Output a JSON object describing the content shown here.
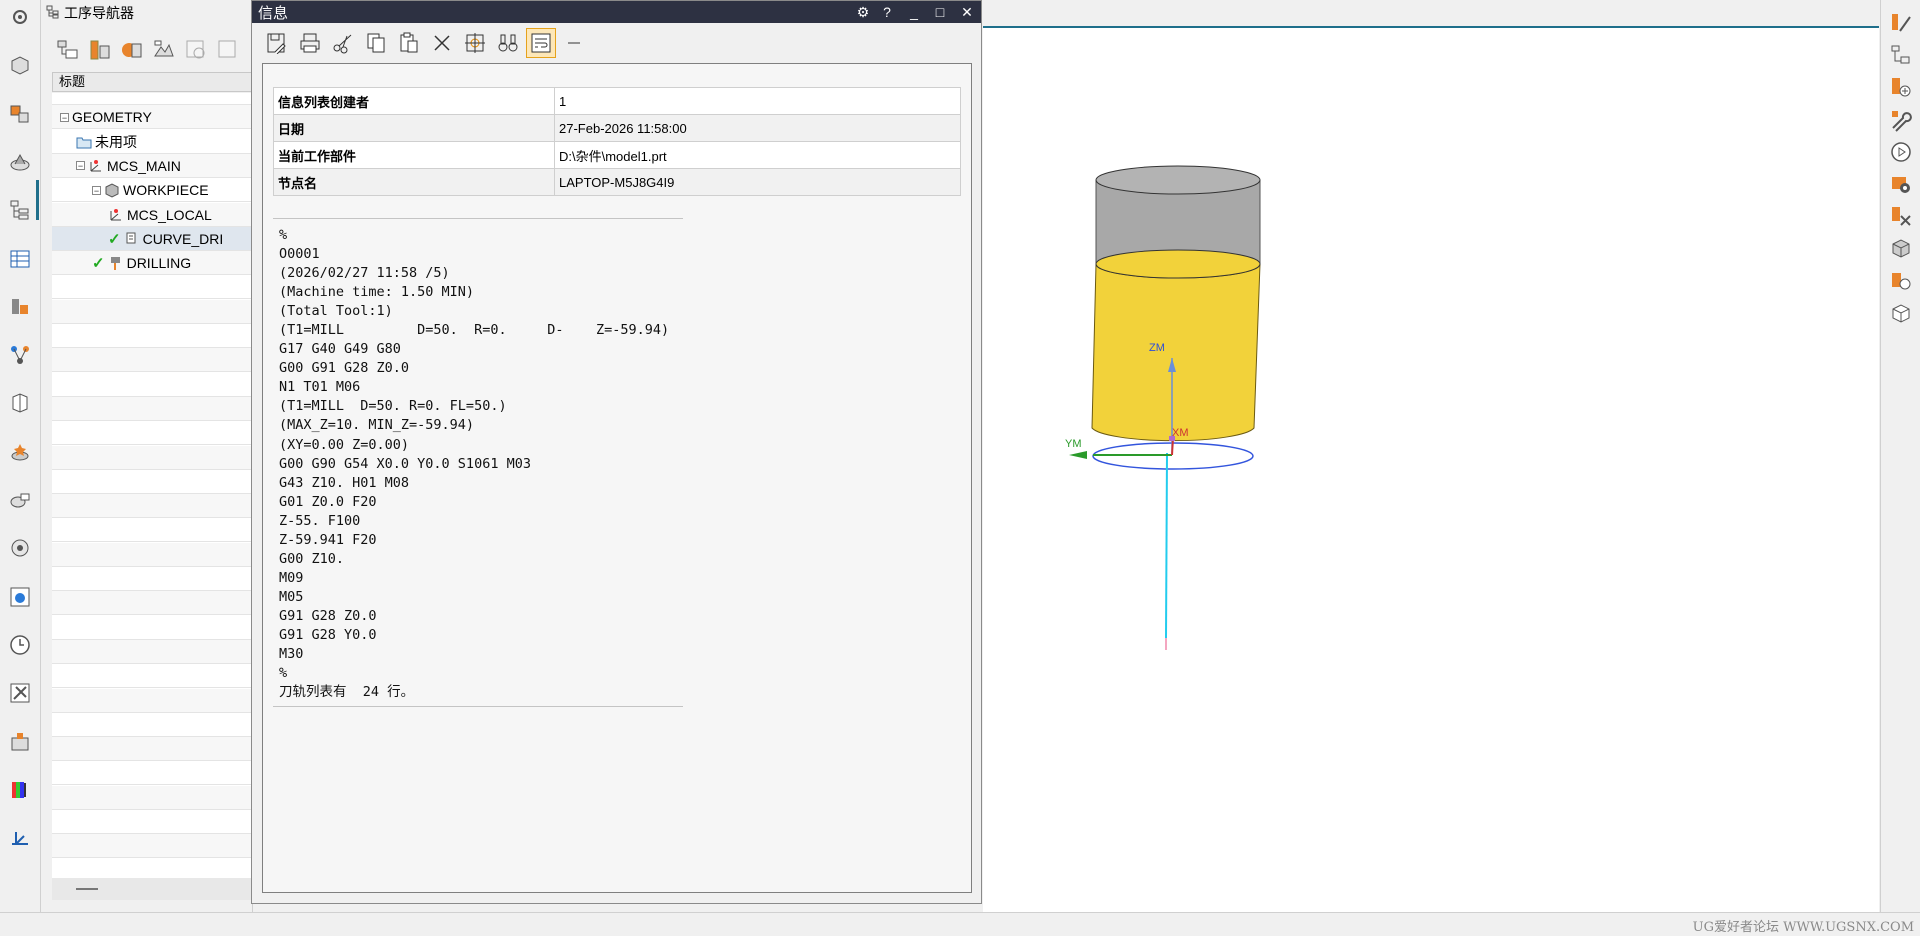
{
  "left_toolbar": {
    "icons": [
      "settings-gear-icon",
      "part-icon",
      "assembly-navigator-icon",
      "constraint-icon",
      "operation-navigator-icon",
      "table-icon",
      "machine-tool-icon",
      "feature-icon",
      "part-family-icon",
      "reuse-icon",
      "process-icon",
      "roles-icon",
      "web-browser-icon",
      "history-clock-icon",
      "tool-library-icon",
      "machine-icon",
      "color-palette-icon",
      "measure-icon"
    ]
  },
  "right_toolbar": {
    "icons": [
      "tool-edit-icon",
      "program-order-icon",
      "insert-operation-icon",
      "wrench-icon",
      "play-icon",
      "verify-icon",
      "delete-path-icon",
      "cube-icon",
      "feature-machining-icon",
      "wireframe-icon"
    ]
  },
  "navigator": {
    "title": "工序导航器",
    "column_header": "标题",
    "tree": [
      {
        "label": "GEOMETRY",
        "indent": 0,
        "expand": "−",
        "icon": "none",
        "check": false
      },
      {
        "label": "未用项",
        "indent": 1,
        "expand": "",
        "icon": "folder",
        "check": false
      },
      {
        "label": "MCS_MAIN",
        "indent": 1,
        "expand": "−",
        "icon": "mcs",
        "check": false
      },
      {
        "label": "WORKPIECE",
        "indent": 2,
        "expand": "−",
        "icon": "workpiece",
        "check": false
      },
      {
        "label": "MCS_LOCAL",
        "indent": 3,
        "expand": "",
        "icon": "mcs",
        "check": false
      },
      {
        "label": "CURVE_DRI",
        "indent": 3,
        "expand": "",
        "icon": "operation",
        "check": true
      },
      {
        "label": "DRILLING",
        "indent": 2,
        "expand": "",
        "icon": "drill",
        "check": true
      }
    ]
  },
  "info_dialog": {
    "title": "信息",
    "controls": {
      "settings": "⚙",
      "help": "?",
      "minimize": "_",
      "maximize": "□",
      "close": "✕"
    },
    "table": [
      {
        "key": "信息列表创建者",
        "value": "1"
      },
      {
        "key": "日期",
        "value": "27-Feb-2026 11:58:00"
      },
      {
        "key": "当前工作部件",
        "value": "D:\\杂件\\model1.prt"
      },
      {
        "key": "节点名",
        "value": "LAPTOP-M5J8G4I9"
      }
    ],
    "nc_code": "%\nO0001\n(2026/02/27 11:58 /5)\n(Machine time: 1.50 MIN)\n(Total Tool:1)\n(T1=MILL         D=50.  R=0.     D-    Z=-59.94)\nG17 G40 G49 G80\nG00 G91 G28 Z0.0\nN1 T01 M06\n(T1=MILL  D=50. R=0. FL=50.)\n(MAX_Z=10. MIN_Z=-59.94)\n(XY=0.00 Z=0.00)\nG00 G90 G54 X0.0 Y0.0 S1061 M03\nG43 Z10. H01 M08\nG01 Z0.0 F20\nZ-55. F100\nZ-59.941 F20\nG00 Z10.\nM09\nM05\nG91 G28 Z0.0\nG91 G28 Y0.0\nM30\n%\n刀轨列表有  24 行。"
  },
  "graphics": {
    "axis_labels": {
      "zm": "ZM",
      "ym": "YM",
      "xm": "XM"
    },
    "colors": {
      "cylinder_top": "#a8a8a8",
      "cylinder_body": "#f2d23a",
      "axis_z": "#2e4fd8",
      "axis_y": "#2a9a2a",
      "axis_x": "#cc3333",
      "tool_path": "#22ccee",
      "circle": "#3355dd"
    }
  },
  "status": {
    "watermark": "UG爱好者论坛 WWW.UGSNX.COM"
  }
}
